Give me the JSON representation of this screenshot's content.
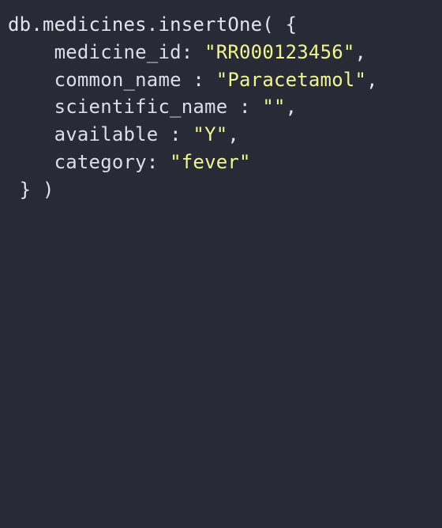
{
  "code": {
    "line1": {
      "a": "db",
      "b": ".medicines.insertOne",
      "c": "( {"
    },
    "fields": {
      "medicine_id": {
        "key": "medicine_id",
        "colon": ": ",
        "val": "\"RR000123456\"",
        "comma": ","
      },
      "common_name": {
        "key": "common_name ",
        "colon": ": ",
        "val": "\"Paracetamol\"",
        "comma": ","
      },
      "scientific_name": {
        "key": "scientific_name ",
        "colon": ": ",
        "val": "\"\"",
        "comma": ","
      },
      "available": {
        "key": "available ",
        "colon": ": ",
        "val": "\"Y\"",
        "comma": ","
      },
      "category": {
        "key": "category",
        "colon": ": ",
        "val": "\"fever\"",
        "comma": ""
      }
    },
    "close": " } )"
  }
}
